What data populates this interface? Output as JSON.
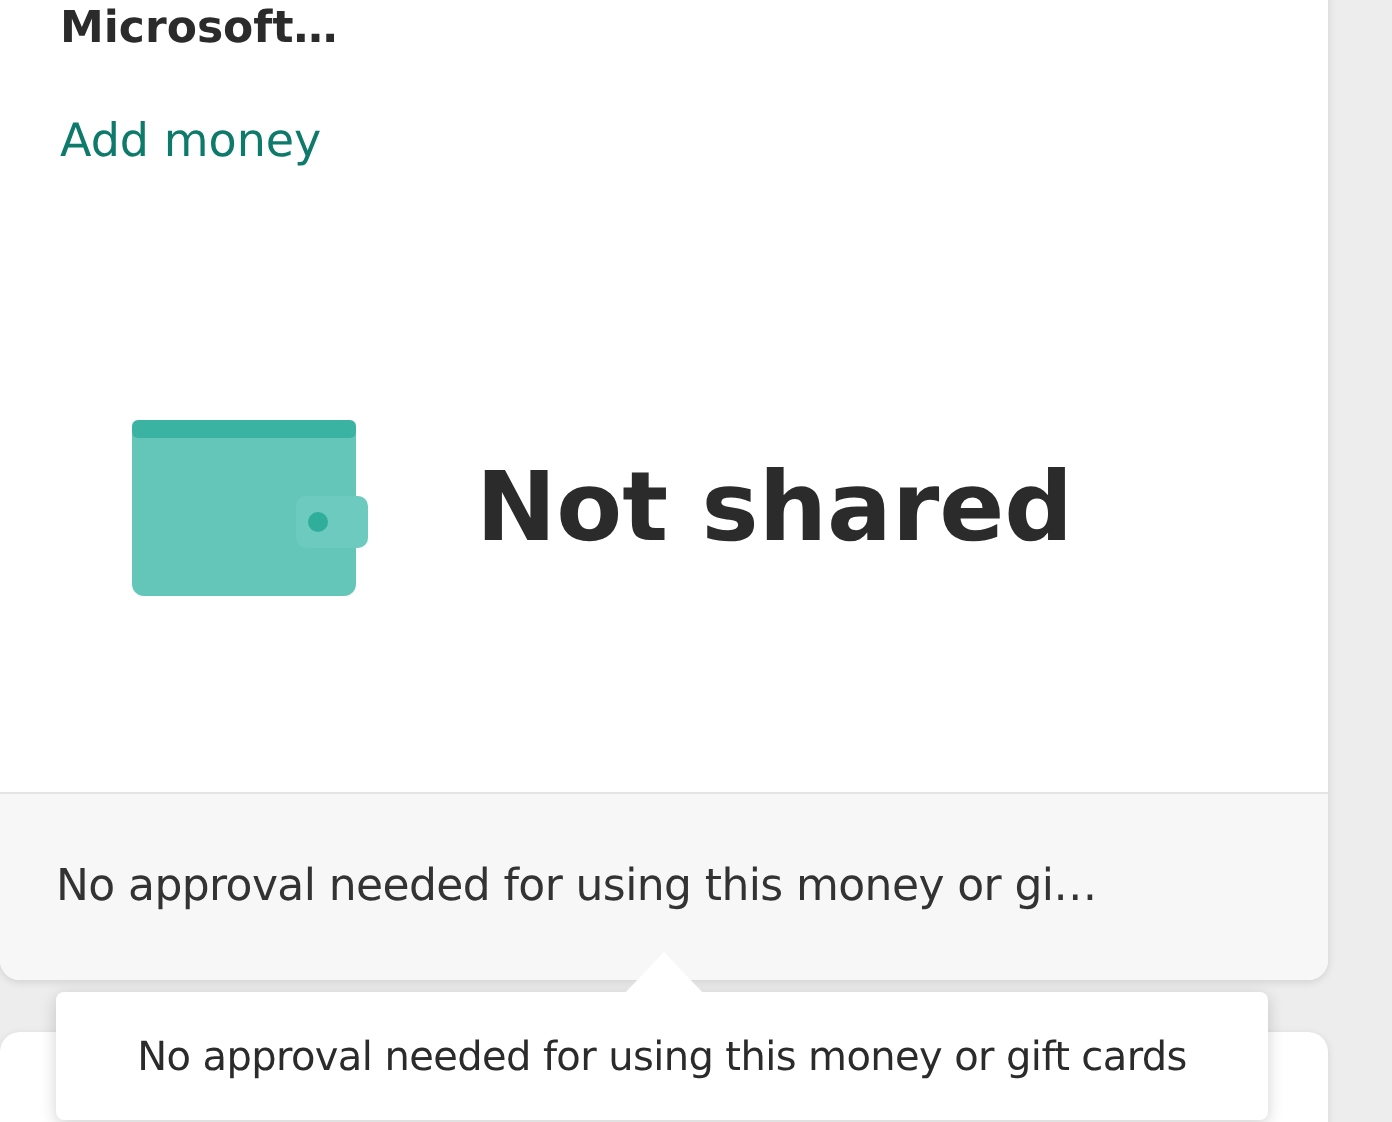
{
  "card": {
    "title": "Microsoft…",
    "link": "Add money",
    "sharing_status": "Not shared",
    "footer": "No approval needed for using this money or gi…"
  },
  "tooltip": {
    "text": "No approval needed for using this money or gift cards"
  }
}
